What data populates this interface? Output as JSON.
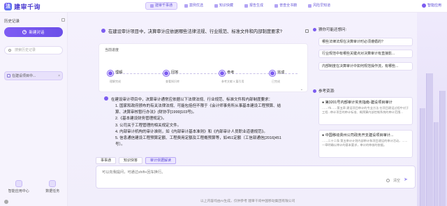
{
  "app": {
    "logo_mark": "法",
    "logo_text": "建审千询",
    "smart_button": "智能应用"
  },
  "nav": {
    "tabs": [
      "建审千事通",
      "案例优选",
      "知识快藏",
      "报告生成",
      "普查全书籍",
      "风险早知道"
    ],
    "active_index": 0
  },
  "sidebar": {
    "title": "历史记录",
    "new_chat": "新建对话",
    "search_placeholder": "搜索历史记录",
    "history": [
      "在建设项目中..."
    ],
    "footer": [
      "智能应用中心",
      "数据任务"
    ]
  },
  "question": "在建设审计项目中，决算审计应依据哪些法律法规、行业规范、标准文件和内部制度要求?",
  "progress": {
    "label": "当前进度",
    "stages": [
      {
        "name": "理解",
        "status": "理解完成"
      },
      {
        "name": "回答",
        "status": "查看知识库"
      },
      {
        "name": "参考",
        "status": "参考文献 5 篇引用"
      },
      {
        "name": "完成",
        "status": "已完成"
      }
    ],
    "more": "⌄"
  },
  "answer": {
    "intro": "在建设审计项目中，决算审计通常应依据以下法律法规、行业规范、标准文件和内部制度要求：",
    "items": [
      "1. 国家和政府颁布的有关法律法规、可能包括但不限于《会计师事务所从事基本建设工程预算、结",
      "    算、决算审核暂行办法》(财协字[1999]103号)。",
      "2.《基本建设财务管理规定》。",
      "3. 公司关于工程管理的相关规定文件。",
      "4. 内部审计机构的审计准则，如《内部审计基本准则》和《内部审计人员职业道德规范》。",
      "5. 信息通信建设工程预算定额、工程费用定额及工程概预算等，如451定额（工信部通信[2016]451",
      "    号）。"
    ],
    "tabs": [
      "事事通",
      "知识快答",
      "审计依据解读"
    ],
    "active_tab": 2
  },
  "input": {
    "placeholder": "可以向我提问，可通过shift+回车换行。",
    "clear": "清空",
    "send_glyph": "➤"
  },
  "disclaimer": "以上内容均由AI生成，仅供参考          建审千询中国移动集团有限公司",
  "right_panel": {
    "suggest_title": "猜你可能还想问:",
    "suggestions": [
      "哪些法律法规在决算审计时必须遵循的?",
      "行业规范中有哪些关键点对决算审计有直接影...",
      "内部制度在决算审计中如何规范操作流，有哪些..."
    ],
    "ref_title": "参考资源:",
    "refs": [
      {
        "title": "● 第3201号内部审计实务指南-建设项目审计",
        "body": "……7b……第五章 建设项目审计的专业方法 在项目建设过程中对于工程...审计项目的审计标准、概预算内部控制系统的审计范围..."
      },
      {
        "title": "● 中国移动贵州公司政务开支建设项目审计...",
        "body": "……二十二条 第五审计计划内部审计和项目建设的审计活动，……一章明确以审计的基本要求，审计的审核的依据。"
      }
    ]
  }
}
